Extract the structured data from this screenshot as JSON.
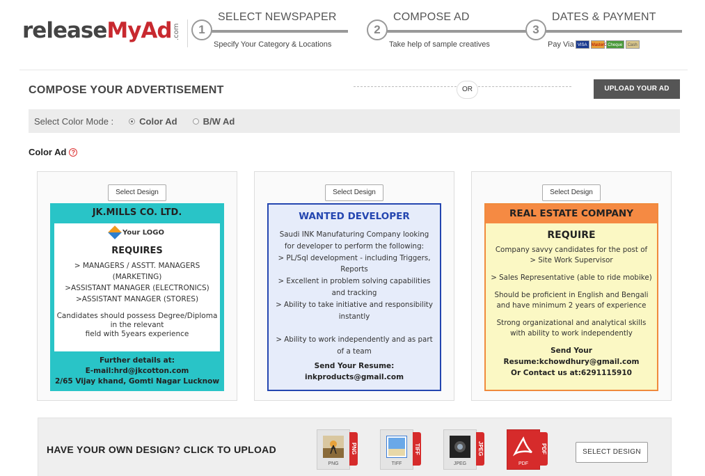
{
  "brand": {
    "name_part1": "release",
    "name_part2": "MyAd",
    "suffix": ".com"
  },
  "steps": [
    {
      "number": "1",
      "title": "SELECT NEWSPAPER",
      "subtitle": "Specify Your Category & Locations"
    },
    {
      "number": "2",
      "title": "COMPOSE AD",
      "subtitle": "Take help of sample creatives"
    },
    {
      "number": "3",
      "title": "DATES & PAYMENT",
      "subtitle": "Pay Via"
    }
  ],
  "payment_methods": [
    "VISA",
    "MasterCard",
    "Cheque",
    "Cash"
  ],
  "compose": {
    "title": "COMPOSE YOUR ADVERTISEMENT",
    "or_label": "OR",
    "upload_ad_button": "UPLOAD YOUR AD"
  },
  "color_mode": {
    "label": "Select Color Mode :",
    "options": [
      "Color Ad",
      "B/W Ad"
    ],
    "selected": "Color Ad"
  },
  "section_label": "Color Ad",
  "select_design_label": "Select Design",
  "templates": [
    {
      "heading": "JK.MILLS CO. LTD.",
      "logo_text": "Your LOGO",
      "requires": "REQUIRES",
      "lines": [
        "> MANAGERS / ASSTT. MANAGERS",
        "(MARKETING)",
        ">ASSISTANT MANAGER (ELECTRONICS)",
        ">ASSISTANT MANAGER (STORES)"
      ],
      "candidates": [
        "Candidates should possess Degree/Diploma",
        "in the relevant",
        "field with 5years experience"
      ],
      "footer": [
        "Further details at:",
        "E-mail:hrd@jkcotton.com",
        "2/65 Vijay khand, Gomti Nagar Lucknow"
      ]
    },
    {
      "heading": "WANTED DEVELOPER",
      "lines": [
        "Saudi INK Manufaturing Company looking",
        "for developer to perform the following:",
        "> PL/Sql development - including Triggers,",
        "Reports",
        "> Excellent in problem solving capabilities",
        "and tracking",
        "> Ability to take initiative and responsibility",
        "instantly",
        "",
        "> Ability to work independently and as part",
        "of a team"
      ],
      "footer": [
        "Send Your Resume:",
        "inkproducts@gmail.com"
      ]
    },
    {
      "heading": "REAL ESTATE COMPANY",
      "requires": "REQUIRE",
      "paragraphs": [
        [
          "Company savvy candidates for the post of",
          "> Site Work Supervisor"
        ],
        [
          "> Sales Representative (able to ride mobike)"
        ],
        [
          "Should be proficient in English and Bengali",
          "and have minimum 2 years of  experience"
        ],
        [
          "Strong organizational and analytical skills",
          "with ability to work independently"
        ]
      ],
      "footer": [
        "Send Your Resume:kchowdhury@gmail.com",
        "Or Contact us at:6291115910"
      ]
    }
  ],
  "upload": {
    "prompt": "HAVE YOUR OWN DESIGN? CLICK TO UPLOAD",
    "file_types": [
      {
        "caption": "PNG",
        "ribbon": "PNG"
      },
      {
        "caption": "TIFF",
        "ribbon": "TIFF"
      },
      {
        "caption": "JPEG",
        "ribbon": "JPEG"
      },
      {
        "caption": "PDF",
        "ribbon": "PDF"
      }
    ],
    "select_design_button": "SELECT DESIGN"
  },
  "colors": {
    "brand_red": "#c8292f",
    "teal": "#29c4c7",
    "blue": "#2446b0",
    "orange": "#f58a43",
    "dark_button": "#555555"
  }
}
